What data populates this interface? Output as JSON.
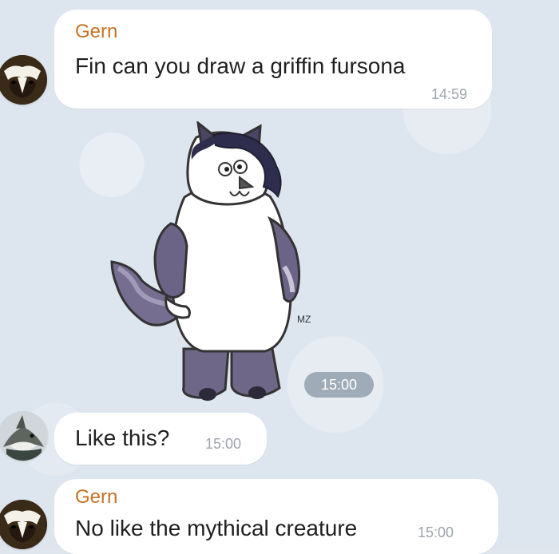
{
  "messages": [
    {
      "sender": "Gern",
      "text": "Fin can you draw a griffin fursona",
      "time": "14:59",
      "avatar_icon": "badger-avatar-icon"
    },
    {
      "type": "sticker",
      "time": "15:00",
      "sticker_icon": "cartoon-character-sticker"
    },
    {
      "text": "Like this?",
      "time": "15:00",
      "avatar_icon": "shark-avatar-icon"
    },
    {
      "sender": "Gern",
      "text": "No like the mythical creature",
      "time": "15:00",
      "avatar_icon": "badger-avatar-icon"
    }
  ],
  "colors": {
    "sender_name": "#c77324",
    "bubble_bg": "#ffffff",
    "chat_bg": "#dde5ee",
    "timestamp": "#9ea4ab",
    "sticker_time_bg": "#8491a0"
  }
}
